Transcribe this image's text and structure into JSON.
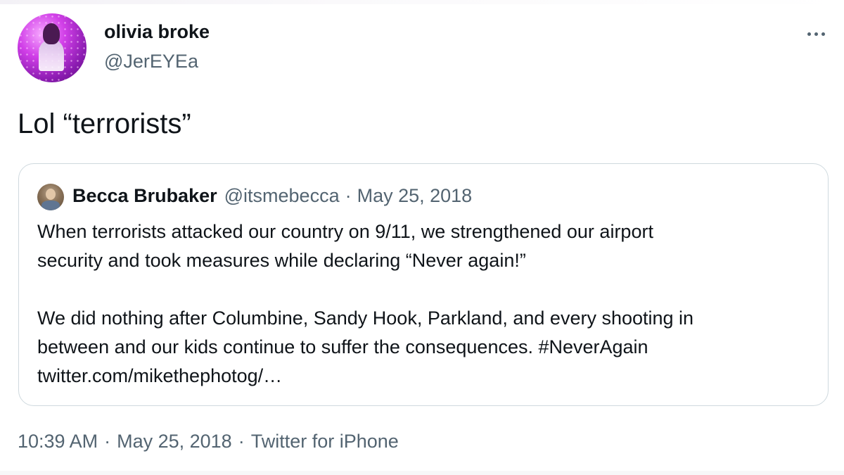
{
  "author": {
    "display_name": "olivia broke",
    "handle": "@JerEYEa"
  },
  "tweet": {
    "text": "Lol “terrorists”"
  },
  "quoted_tweet": {
    "display_name": "Becca Brubaker",
    "handle": "@itsmebecca",
    "separator": "·",
    "date": "May 25, 2018",
    "lines": [
      "When terrorists attacked our country on 9/11, we strengthened our airport",
      "security and took measures while declaring “Never again!”",
      "We did nothing after Columbine, Sandy Hook, Parkland, and every shooting in",
      "between and our kids continue to suffer the consequences. #NeverAgain",
      "twitter.com/mikethephotog/…"
    ]
  },
  "footer": {
    "time": "10:39 AM",
    "separator": "·",
    "date": "May 25, 2018",
    "source": "Twitter for iPhone"
  },
  "icons": {
    "more": "more-horizontal-icon"
  },
  "colors": {
    "text_primary": "#0f1419",
    "text_secondary": "#536471",
    "border": "#cfd9de",
    "avatar_accent": "#d13fe8"
  }
}
